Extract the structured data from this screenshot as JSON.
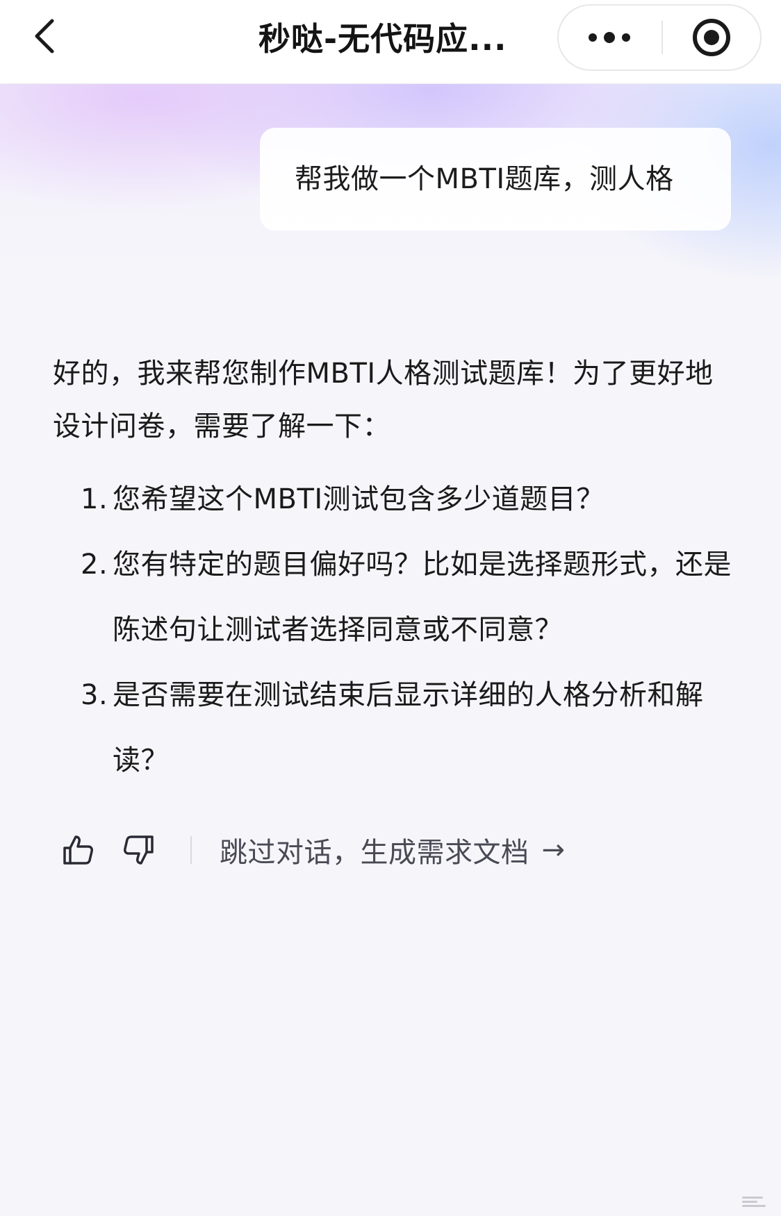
{
  "topbar": {
    "back_icon": "chevron-left-icon",
    "title": "秒哒-无代码应...",
    "more_icon": "more-dots-icon",
    "record_icon": "record-target-icon"
  },
  "conversation": {
    "user_message": "帮我做一个MBTI题库，测人格",
    "reply_intro": "好的，我来帮您制作MBTI人格测试题库！为了更好地设计问卷，需要了解一下：",
    "questions": [
      {
        "num": "1.",
        "text": "您希望这个MBTI测试包含多少道题目？"
      },
      {
        "num": "2.",
        "text": "您有特定的题目偏好吗？比如是选择题形式，还是陈述句让测试者选择同意或不同意？"
      },
      {
        "num": "3.",
        "text": "是否需要在测试结束后显示详细的人格分析和解读？"
      }
    ]
  },
  "actions": {
    "like_icon": "thumbs-up-icon",
    "dislike_icon": "thumbs-down-icon",
    "skip_label": "跳过对话，生成需求文档",
    "skip_arrow": "→"
  },
  "colors": {
    "accent_purple": "#d8c4fa",
    "accent_blue": "#bacefc",
    "text_primary": "#1a1a1a",
    "text_secondary": "#4a4a55",
    "background": "#f6f6fa"
  }
}
